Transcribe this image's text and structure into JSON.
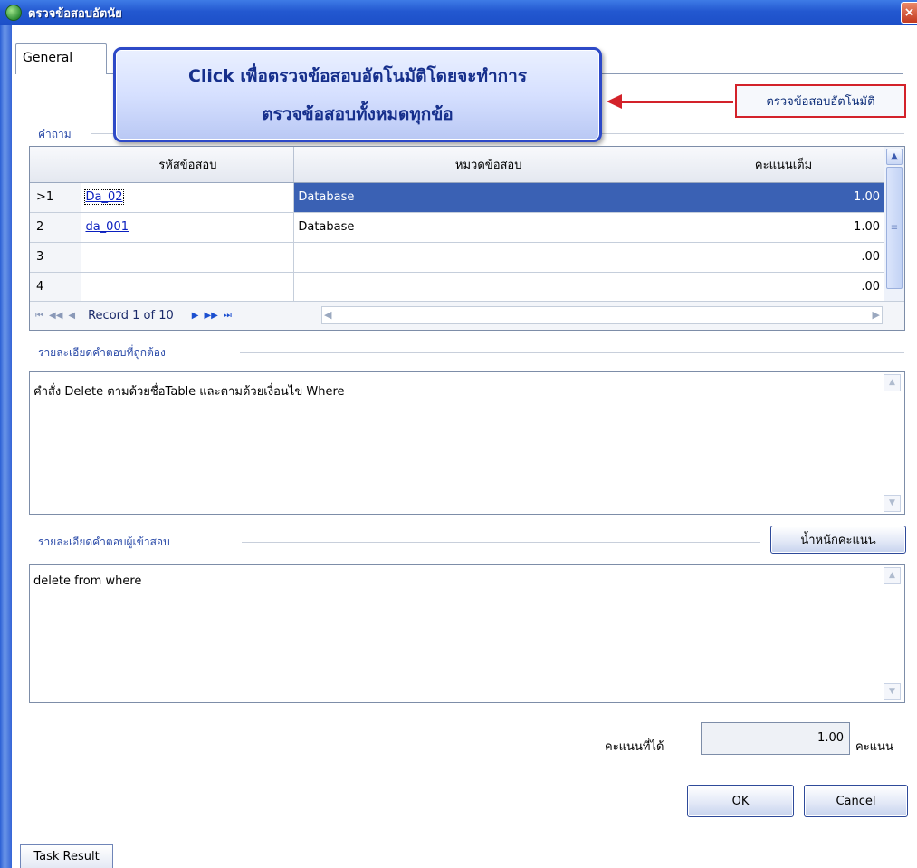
{
  "window": {
    "title": "ตรวจข้อสอบอัตนัย",
    "close_glyph": "×"
  },
  "tabs": [
    {
      "label": "General"
    }
  ],
  "callout": {
    "line1": "Click เพื่อตรวจข้อสอบอัตโนมัติโดยจะทำการ",
    "line2": "ตรวจข้อสอบทั้งหมดทุกข้อ"
  },
  "auto_check_button": {
    "label": "ตรวจข้อสอบอัตโนมัติ"
  },
  "question_label": "คำถาม",
  "grid": {
    "columns": [
      "",
      "รหัสข้อสอบ",
      "หมวดข้อสอบ",
      "คะแนนเต็ม"
    ],
    "rows": [
      {
        "num": "1",
        "marker": ">",
        "code": "Da_02",
        "category": "Database",
        "score": "1.00",
        "selected": true
      },
      {
        "num": "2",
        "marker": "",
        "code": "da_001",
        "category": "Database",
        "score": "1.00",
        "selected": false
      },
      {
        "num": "3",
        "marker": "",
        "code": "",
        "category": "",
        "score": ".00",
        "selected": false
      },
      {
        "num": "4",
        "marker": "",
        "code": "",
        "category": "",
        "score": ".00",
        "selected": false
      }
    ],
    "pager": {
      "record_text": "Record 1 of 10"
    }
  },
  "correct_answer": {
    "label": "รายละเอียดคำตอบที่ถูกต้อง",
    "text": "คำสั่ง Delete ตามด้วยชื่อTable และตามด้วยเงื่อนไข Where"
  },
  "examinee_answer": {
    "label": "รายละเอียดคำตอบผู้เข้าสอบ",
    "text": "delete from  where",
    "weight_button": "น้ำหนักคะแนน"
  },
  "score": {
    "label": "คะแนนที่ได้",
    "value": "1.00",
    "unit": "คะแนน"
  },
  "buttons": {
    "ok": "OK",
    "cancel": "Cancel"
  },
  "taskbar": {
    "task_result": "Task Result"
  },
  "colors": {
    "title_bar": "#2358d0",
    "selection": "#3a61b4",
    "callout_border": "#2d49c7",
    "arrow": "#d3222a",
    "label_blue": "#2a4aa8"
  }
}
